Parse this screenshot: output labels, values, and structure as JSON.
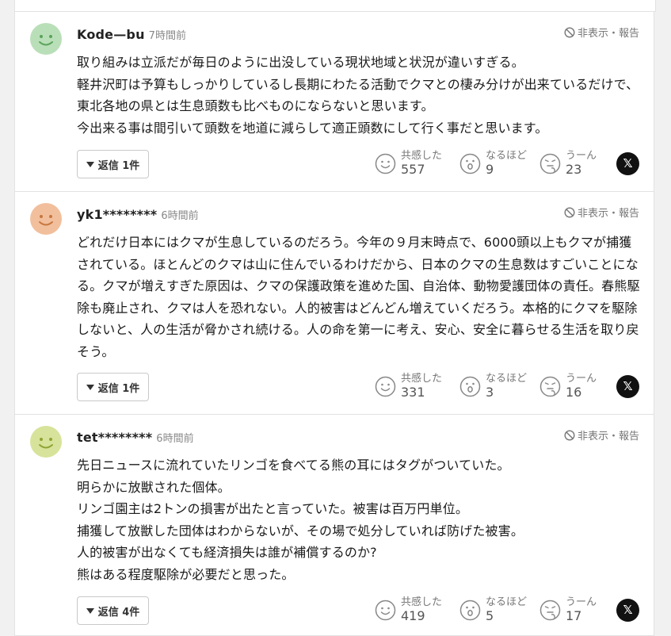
{
  "hide_report_label": "非表示・報告",
  "reply_prefix": "返信",
  "reaction_labels": [
    "共感した",
    "なるほど",
    "うーん"
  ],
  "x_icon_glyph": "𝕏",
  "comments": [
    {
      "avatar_color": "#b9dfb8",
      "avatar_face": "#5aa35b",
      "username": "Kode—bu",
      "time": "7時間前",
      "body": "取り組みは立派だが毎日のように出没している現状地域と状況が違いすぎる。\n軽井沢町は予算もしっかりしているし長期にわたる活動でクマとの棲み分けが出来ているだけで、東北各地の県とは生息頭数も比べものにならないと思います。\n今出来る事は間引いて頭数を地道に減らして適正頭数にして行く事だと思います。",
      "reply_label": "返信 1件",
      "counts": [
        "557",
        "9",
        "23"
      ]
    },
    {
      "avatar_color": "#f2bf9c",
      "avatar_face": "#c7773f",
      "username": "yk1********",
      "time": "6時間前",
      "body": "どれだけ日本にはクマが生息しているのだろう。今年の９月末時点で、6000頭以上もクマが捕獲されている。ほとんどのクマは山に住んでいるわけだから、日本のクマの生息数はすごいことになる。クマが増えすぎた原因は、クマの保護政策を進めた国、自治体、動物愛護団体の責任。春熊駆除も廃止され、クマは人を恐れない。人的被害はどんどん増えていくだろう。本格的にクマを駆除しないと、人の生活が脅かされ続ける。人の命を第一に考え、安心、安全に暮らせる生活を取り戻そう。",
      "reply_label": "返信 1件",
      "counts": [
        "331",
        "3",
        "16"
      ]
    },
    {
      "avatar_color": "#d7e39a",
      "avatar_face": "#8fa336",
      "username": "tet********",
      "time": "6時間前",
      "body": "先日ニュースに流れていたリンゴを食べてる熊の耳にはタグがついていた。\n明らかに放獣された個体。\nリンゴ園主は2トンの損害が出たと言っていた。被害は百万円単位。\n捕獲して放獣した団体はわからないが、その場で処分していれば防げた被害。\n人的被害が出なくても経済損失は誰が補償するのか?\n熊はある程度駆除が必要だと思った。",
      "reply_label": "返信 4件",
      "counts": [
        "419",
        "5",
        "17"
      ]
    }
  ]
}
